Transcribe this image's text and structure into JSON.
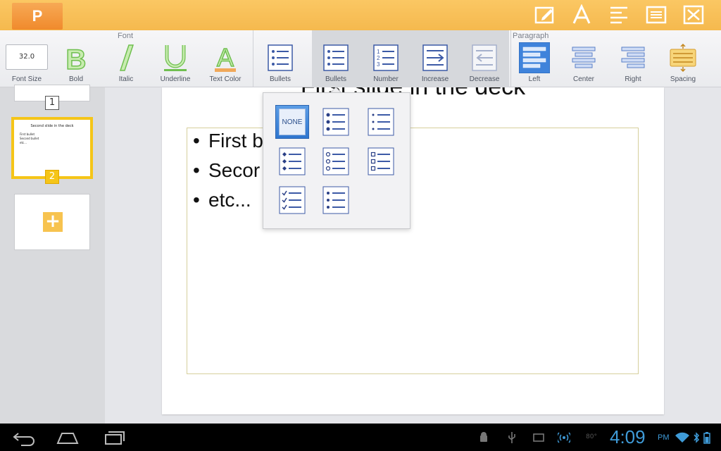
{
  "app": {
    "logo_letter": "P"
  },
  "ribbon": {
    "font_group_label": "Font",
    "paragraph_group_label": "Paragraph",
    "font_size_value": "32.0",
    "buttons": {
      "font_size": "Font Size",
      "bold": "Bold",
      "italic": "Italic",
      "underline": "Underline",
      "text_color": "Text Color",
      "bullets": "Bullets",
      "bullets_active": "Bullets",
      "number": "Number",
      "increase": "Increase",
      "decrease": "Decrease",
      "left": "Left",
      "center": "Center",
      "right": "Right",
      "spacing": "Spacing"
    }
  },
  "thumbnails": {
    "slide1_number": "1",
    "slide2_number": "2",
    "slide2_preview_title": "Second slide in the deck",
    "slide2_preview_lines": [
      "First bullet",
      "Second bullet",
      "etc..."
    ]
  },
  "slide": {
    "title": "First slide in the deck",
    "bullets": [
      "First b",
      "Secor",
      "etc..."
    ],
    "bullet_symbol": "•"
  },
  "bullet_popup": {
    "none_label": "NONE",
    "selected": "none"
  },
  "status_bar": {
    "time": "4:09",
    "ampm": "PM",
    "temperature": "80°"
  },
  "colors": {
    "topbar": "#f5b94e",
    "accent_blue": "#3f7fd6",
    "selected_thumb": "#f5c518",
    "clock": "#3f9bd8"
  }
}
